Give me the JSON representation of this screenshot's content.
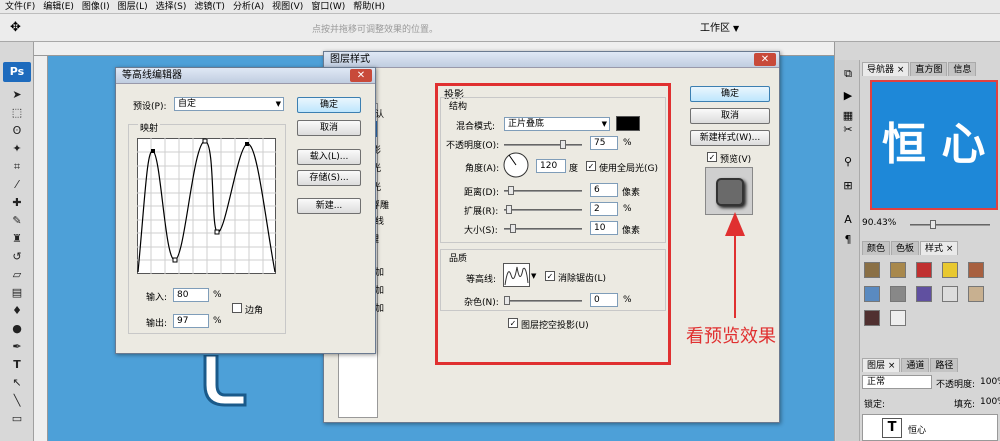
{
  "menu": [
    "文件(F)",
    "编辑(E)",
    "图像(I)",
    "图层(L)",
    "选择(S)",
    "滤镜(T)",
    "分析(A)",
    "视图(V)",
    "窗口(W)",
    "帮助(H)"
  ],
  "options_bar": {
    "hint": "点按并拖移可调整效果的位置。",
    "workspace": "工作区",
    "workspace_arrow": "▼"
  },
  "ps_logo": "Ps",
  "right_panel": {
    "tabs_top": [
      "导航器 ×",
      "直方图",
      "信息"
    ],
    "zoom": "90.43%",
    "tabs_mid": [
      "颜色",
      "色板",
      "样式 ×"
    ],
    "tabs_layers": [
      "图层 ×",
      "通道",
      "路径"
    ],
    "blend_mode": "正常",
    "opacity_label": "不透明度:",
    "opacity_value": "100%",
    "lock_label": "锁定:",
    "fill_label": "填充:",
    "fill_value": "100%",
    "layer_name": "恒心",
    "layer_thumb": "T",
    "nav_text": "恒 心"
  },
  "contour_editor": {
    "title": "等高线编辑器",
    "preset_label": "预设(P):",
    "preset_value": "自定",
    "mapping_label": "映射",
    "input_label": "输入:",
    "input_value": "80",
    "output_label": "输出:",
    "output_value": "97",
    "percent": "%",
    "corner_label": "边角",
    "buttons": {
      "ok": "确定",
      "cancel": "取消",
      "load": "载入(L)...",
      "save": "存储(S)...",
      "new": "新建..."
    }
  },
  "layer_style": {
    "title": "图层样式",
    "style_list": [
      "默认",
      "影",
      "光",
      "光",
      "和浮雕",
      "高线",
      "理",
      "",
      "叠加",
      "叠加",
      "叠加",
      "",
      ""
    ],
    "section_title": "投影",
    "structure": "结构",
    "blend_label": "混合模式:",
    "blend_value": "正片叠底",
    "opacity_label": "不透明度(O):",
    "opacity_value": "75",
    "angle_label": "角度(A):",
    "angle_value": "120",
    "degree": "度",
    "global_light": "使用全局光(G)",
    "distance_label": "距离(D):",
    "distance_value": "6",
    "spread_label": "扩展(R):",
    "spread_value": "2",
    "size_label": "大小(S):",
    "size_value": "10",
    "px": "像素",
    "percent": "%",
    "quality": "品质",
    "contour_label": "等高线:",
    "antialias": "消除锯齿(L)",
    "noise_label": "杂色(N):",
    "noise_value": "0",
    "knockout": "图层挖空投影(U)",
    "buttons": {
      "ok": "确定",
      "cancel": "取消",
      "new_style": "新建样式(W)...",
      "preview": "预览(V)"
    }
  },
  "annotation": "看预览效果",
  "colors": {
    "accent_red": "#e03030",
    "canvas_blue": "#4da0d8"
  }
}
